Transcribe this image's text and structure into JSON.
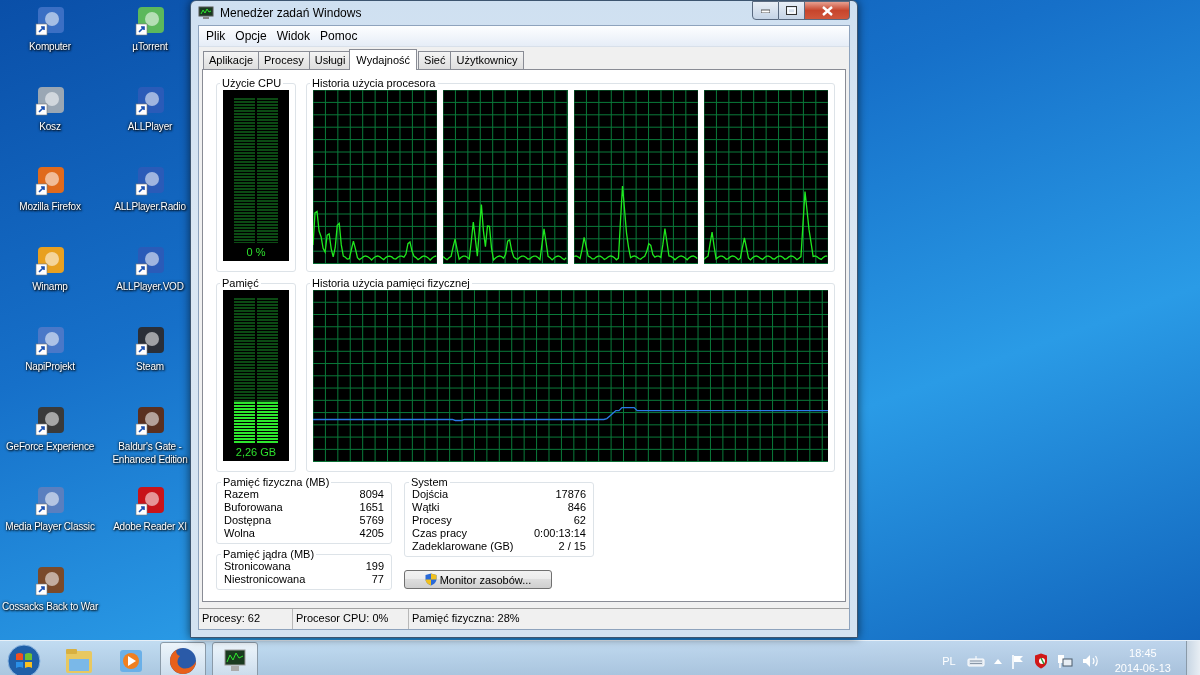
{
  "desktop_icons": [
    {
      "label": "Komputer"
    },
    {
      "label": "Kosz"
    },
    {
      "label": "Mozilla Firefox"
    },
    {
      "label": "Winamp"
    },
    {
      "label": "NapiProjekt"
    },
    {
      "label": "GeForce Experience"
    },
    {
      "label": "Media Player Classic"
    },
    {
      "label": "Cossacks Back to War"
    },
    {
      "label": "µTorrent"
    },
    {
      "label": "ALLPlayer"
    },
    {
      "label": "ALLPlayer.Radio"
    },
    {
      "label": "ALLPlayer.VOD"
    },
    {
      "label": "Steam"
    },
    {
      "label": "Baldur's Gate - Enhanced Edition"
    },
    {
      "label": "Adobe Reader XI"
    }
  ],
  "task_manager": {
    "title": "Menedżer zadań Windows",
    "menu": [
      "Plik",
      "Opcje",
      "Widok",
      "Pomoc"
    ],
    "tabs": [
      {
        "label": "Aplikacje",
        "selected": false
      },
      {
        "label": "Procesy",
        "selected": false
      },
      {
        "label": "Usługi",
        "selected": false
      },
      {
        "label": "Wydajność",
        "selected": true
      },
      {
        "label": "Sieć",
        "selected": false
      },
      {
        "label": "Użytkownicy",
        "selected": false
      }
    ],
    "cpu_usage": {
      "title": "Użycie CPU",
      "level": 0,
      "reading": "0 %"
    },
    "cpu_history": {
      "title": "Historia użycia procesora"
    },
    "memory": {
      "title": "Pamięć",
      "level": 0.28,
      "reading": "2,26 GB"
    },
    "memory_history": {
      "title": "Historia użycia pamięci fizycznej"
    },
    "physical_memory": {
      "title": "Pamięć fizyczna (MB)",
      "rows": [
        {
          "label": "Razem",
          "value": "8094"
        },
        {
          "label": "Buforowana",
          "value": "1651"
        },
        {
          "label": "Dostępna",
          "value": "5769"
        },
        {
          "label": "Wolna",
          "value": "4205"
        }
      ]
    },
    "kernel_memory": {
      "title": "Pamięć jądra (MB)",
      "rows": [
        {
          "label": "Stronicowana",
          "value": "199"
        },
        {
          "label": "Niestronicowana",
          "value": "77"
        }
      ]
    },
    "system": {
      "title": "System",
      "rows": [
        {
          "label": "Dojścia",
          "value": "17876"
        },
        {
          "label": "Wątki",
          "value": "846"
        },
        {
          "label": "Procesy",
          "value": "62"
        },
        {
          "label": "Czas pracy",
          "value": "0:00:13:14"
        },
        {
          "label": "Zadeklarowane (GB)",
          "value": "2 / 15"
        }
      ]
    },
    "resource_monitor_button": "Monitor zasobów...",
    "status_bar": [
      "Procesy: 62",
      "Procesor CPU: 0%",
      "Pamięć fizyczna: 28%"
    ]
  },
  "taskbar": {
    "apps": [
      {
        "running": false
      },
      {
        "running": false
      },
      {
        "running": true
      },
      {
        "running": true
      }
    ],
    "language": "PL",
    "time": "18:45",
    "date": "2014-06-13"
  }
}
